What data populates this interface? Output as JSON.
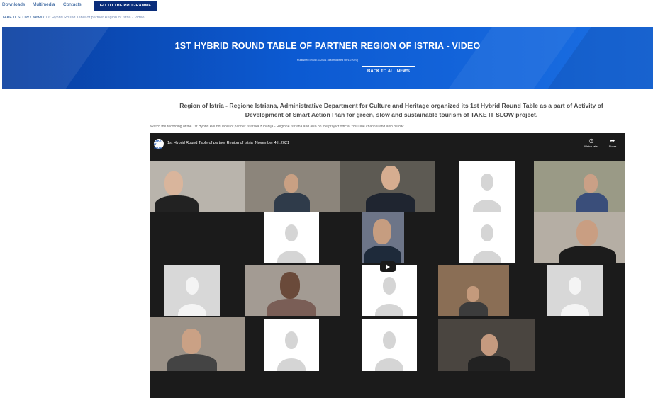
{
  "nav": {
    "links": [
      "Downloads",
      "Multimedia",
      "Contacts"
    ],
    "program_button": "GO TO THE PROGRAMME"
  },
  "breadcrumb": {
    "home": "TAKE IT SLOW",
    "sep1": "/",
    "news": "News",
    "sep2": "/",
    "current": "1st Hybrid Round Table of partner Region of Istria - Video"
  },
  "hero": {
    "title": "1ST HYBRID ROUND TABLE OF PARTNER REGION OF ISTRIA - VIDEO",
    "meta": "Published on 08/11/2021 (last modified 08/11/2021)",
    "back_button": "BACK TO ALL NEWS"
  },
  "article": {
    "intro_line1": "Region of Istria - Regione Istriana, Administrative Department for Culture and Heritage organized its 1st Hybrid Round Table as a part of Activity of",
    "intro_line2": "Development of Smart Action Plan for green, slow and sustainable tourism of TAKE IT SLOW project.",
    "watch_text": "Watch the recording of the 1st Hybrid Round Table of partner Istarska županija - Regione Istriana and also on the project official YouTube channel and also below:"
  },
  "video": {
    "channel_logo_text": "TAKE IT SLOW",
    "title": "1st Hybrid Round Table of partner Region of Istria_November 4th,2021",
    "watch_later_label": "Watch later",
    "share_label": "Share",
    "watch_later_icon": "clock-icon",
    "share_icon": "share-icon",
    "play_icon": "play-icon"
  },
  "colors": {
    "hero_bg": "#0c5ad2",
    "nav_button": "#0a2d7a",
    "link": "#1d4f91",
    "video_bg": "#1b1b1b"
  }
}
